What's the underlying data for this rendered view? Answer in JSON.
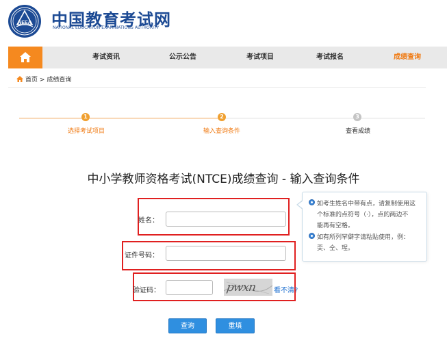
{
  "header": {
    "title_cn": "中国教育考试网",
    "title_en": "NATIONAL EDUCATION EXAMINATIONS AUTHORITY",
    "seal_text": "NEEA"
  },
  "nav": {
    "home_icon": "home-icon",
    "items": [
      {
        "label": "考试资讯"
      },
      {
        "label": "公示公告"
      },
      {
        "label": "考试项目"
      },
      {
        "label": "考试报名"
      },
      {
        "label": "成绩查询"
      }
    ]
  },
  "breadcrumb": {
    "home": "首页",
    "separator": ">",
    "current": "成绩查询"
  },
  "steps": [
    {
      "num": "1",
      "label": "选择考试项目"
    },
    {
      "num": "2",
      "label": "输入查询条件"
    },
    {
      "num": "3",
      "label": "查看成绩"
    }
  ],
  "page_title": "中小学教师资格考试(NTCE)成绩查询 - 输入查询条件",
  "form": {
    "name_label": "姓名：",
    "id_label": "证件号码：",
    "captcha_label": "验证码：",
    "captcha_image_text": "pwxn",
    "refresh_label": "看不清?"
  },
  "tips": {
    "tip1_line1": "如考生姓名中带有点，请复制使用这",
    "tip1_line2": "个标准的点符号（·），点的两边不",
    "tip1_line3": "能再有空格。",
    "tip2_line1": "如有所列罕僻字请粘贴使用，例：",
    "tip2_line2": "奀、仝、瑆。"
  },
  "buttons": {
    "query": "查询",
    "reset": "重填"
  },
  "colors": {
    "brand_blue": "#1c4a94",
    "accent_orange": "#f5891f",
    "highlight_red": "#e02020",
    "button_blue": "#2f8fe0"
  }
}
